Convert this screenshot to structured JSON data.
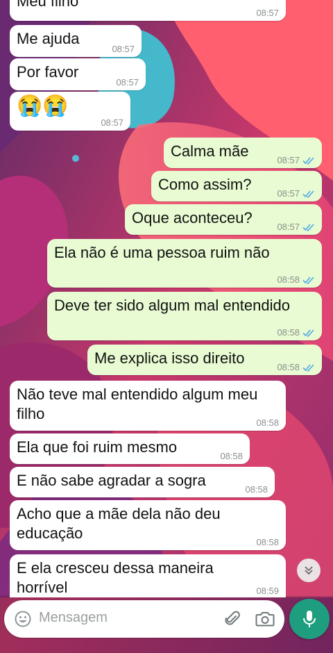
{
  "colors": {
    "incoming_bubble": "#ffffff",
    "outgoing_bubble": "#e8fbd2",
    "read_ticks": "#4fa9e6",
    "mic_button": "#1f9e7f"
  },
  "messages": [
    {
      "direction": "incoming",
      "text": "Meu filho",
      "time": "08:57"
    },
    {
      "direction": "incoming",
      "text": "Me ajuda",
      "time": "08:57"
    },
    {
      "direction": "incoming",
      "text": "Por favor",
      "time": "08:57"
    },
    {
      "direction": "incoming",
      "text": "😭😭",
      "time": "08:57"
    },
    {
      "direction": "outgoing",
      "text": "Calma mãe",
      "time": "08:57",
      "status": "read"
    },
    {
      "direction": "outgoing",
      "text": "Como assim?",
      "time": "08:57",
      "status": "read"
    },
    {
      "direction": "outgoing",
      "text": "Oque aconteceu?",
      "time": "08:57",
      "status": "read"
    },
    {
      "direction": "outgoing",
      "text": "Ela não é uma pessoa ruim não",
      "time": "08:58",
      "status": "read"
    },
    {
      "direction": "outgoing",
      "text": "Deve ter sido algum mal entendido",
      "time": "08:58",
      "status": "read"
    },
    {
      "direction": "outgoing",
      "text": "Me explica isso direito",
      "time": "08:58",
      "status": "read"
    },
    {
      "direction": "incoming",
      "text": "Não teve mal entendido algum meu\nfilho",
      "time": "08:58"
    },
    {
      "direction": "incoming",
      "text": "Ela que foi ruim mesmo",
      "time": "08:58"
    },
    {
      "direction": "incoming",
      "text": "E não sabe agradar a sogra",
      "time": "08:58"
    },
    {
      "direction": "incoming",
      "text": "Acho que a mãe dela não deu\neducação",
      "time": "08:58"
    },
    {
      "direction": "incoming",
      "text": "E ela cresceu dessa maneira\nhorrível",
      "time": "08:59"
    }
  ],
  "composer": {
    "placeholder": "Mensagem",
    "emoji_icon": "emoji-icon",
    "attach_icon": "paperclip-icon",
    "camera_icon": "camera-icon",
    "send_icon": "microphone-icon"
  },
  "scroll_button_icon": "double-chevron-down-icon"
}
